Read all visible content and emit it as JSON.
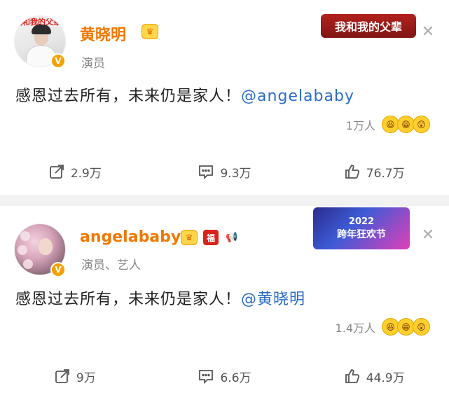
{
  "posts": [
    {
      "avatar_logo_text": "我和我的父辈",
      "name": "黄晓明",
      "subtitle": "演员",
      "banner_text": "我和我的父辈",
      "content_main": "感恩过去所有，未来仍是家人！",
      "content_mention": "@angelababy",
      "reaction_count": "1万人",
      "actions": {
        "share": "2.9万",
        "comment": "9.3万",
        "like": "76.7万"
      },
      "icons": [
        "verified-icon",
        "crown-badge-icon",
        "close-icon",
        "share-icon",
        "comment-icon",
        "like-icon"
      ]
    },
    {
      "name": "angelababy",
      "subtitle": "演员、艺人",
      "banner_year": "2022",
      "banner_text": "跨年狂欢节",
      "content_main": "感恩过去所有，未来仍是家人！",
      "content_mention": "@黄晓明",
      "reaction_count": "1.4万人",
      "actions": {
        "share": "9万",
        "comment": "6.6万",
        "like": "44.9万"
      },
      "badges": {
        "fu": "福"
      },
      "icons": [
        "verified-icon",
        "crown-badge-icon",
        "fu-badge-icon",
        "horn-badge-icon",
        "close-icon",
        "share-icon",
        "comment-icon",
        "like-icon"
      ]
    }
  ],
  "colors": {
    "name": "#f07800",
    "mention": "#2a6cc8",
    "muted": "#888888",
    "verified": "#f6a100"
  }
}
